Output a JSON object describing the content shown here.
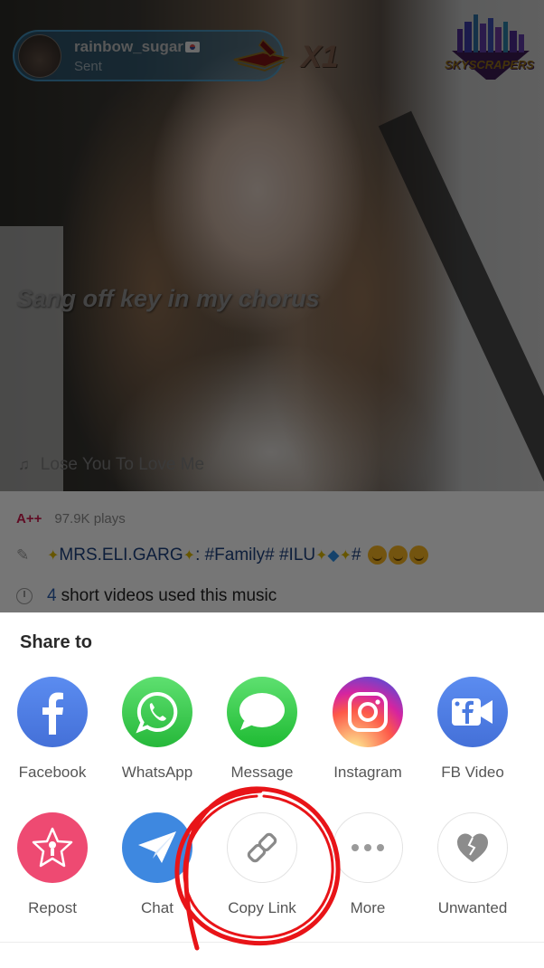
{
  "video": {
    "gift_banner": {
      "username": "rainbow_sugar",
      "status": "Sent",
      "gift_icon": "throne-gift-icon",
      "count": "X1"
    },
    "badge_logo_text": "SKYSCRAPERS",
    "lyric": "Sang off key in my chorus",
    "song_title": "Lose You To Love Me"
  },
  "info": {
    "rating": "A++",
    "plays": "97.9K plays",
    "description": {
      "author": "MRS.ELI.GARG",
      "tags": ": #Family#  #ILU",
      "suffix": "#"
    },
    "videos_count": "4",
    "videos_text": "short videos used this music"
  },
  "share_sheet": {
    "title": "Share to",
    "row1": [
      {
        "label": "Facebook",
        "icon": "facebook-icon",
        "color": "#4a7ae0"
      },
      {
        "label": "WhatsApp",
        "icon": "whatsapp-icon",
        "color": "#2fc445"
      },
      {
        "label": "Message",
        "icon": "message-icon",
        "color": "#31c441"
      },
      {
        "label": "Instagram",
        "icon": "instagram-icon",
        "color": "#c2308c"
      },
      {
        "label": "FB Video",
        "icon": "fb-video-icon",
        "color": "#4a7ae0"
      }
    ],
    "row2": [
      {
        "label": "Repost",
        "icon": "repost-star-mic-icon",
        "color": "#ee4a72"
      },
      {
        "label": "Chat",
        "icon": "paper-plane-icon",
        "color": "#3e88e0"
      },
      {
        "label": "Copy Link",
        "icon": "link-icon",
        "color": "#ffffff"
      },
      {
        "label": "More",
        "icon": "more-dots-icon",
        "color": "#ffffff"
      },
      {
        "label": "Unwanted",
        "icon": "broken-heart-icon",
        "color": "#ffffff"
      }
    ]
  },
  "annotation": {
    "type": "red-circle",
    "target": "Copy Link",
    "color": "#e81418"
  }
}
